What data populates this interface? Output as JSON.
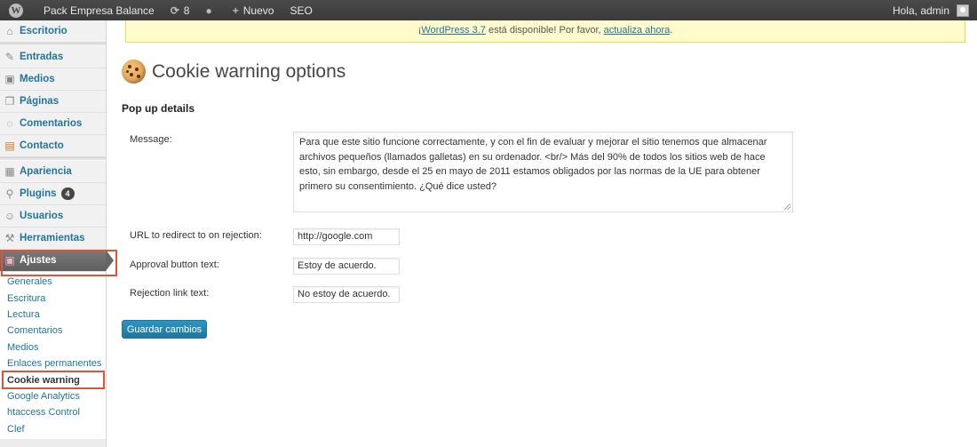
{
  "adminbar": {
    "site_name": "Pack Empresa Balance",
    "updates_count": "8",
    "new_label": "Nuevo",
    "seo_label": "SEO",
    "greeting": "Hola, admin"
  },
  "sidebar": {
    "items": [
      {
        "label": "Escritorio",
        "icon": "dashboard-icon"
      },
      {
        "label": "Entradas",
        "icon": "pin-icon"
      },
      {
        "label": "Medios",
        "icon": "media-icon"
      },
      {
        "label": "Páginas",
        "icon": "pages-icon"
      },
      {
        "label": "Comentarios",
        "icon": "comments-icon"
      },
      {
        "label": "Contacto",
        "icon": "contact-icon"
      },
      {
        "label": "Apariencia",
        "icon": "appearance-icon"
      },
      {
        "label": "Plugins",
        "icon": "plugins-icon",
        "badge": "4"
      },
      {
        "label": "Usuarios",
        "icon": "users-icon"
      },
      {
        "label": "Herramientas",
        "icon": "tools-icon"
      },
      {
        "label": "Ajustes",
        "icon": "settings-icon"
      }
    ],
    "submenu": [
      "Generales",
      "Escritura",
      "Lectura",
      "Comentarios",
      "Medios",
      "Enlaces permanentes",
      "Cookie warning",
      "Google Analytics",
      "htaccess Control",
      "Clef"
    ]
  },
  "notice": {
    "before": "¡",
    "link1": "WordPress 3.7",
    "middle": " está disponible! Por favor, ",
    "link2": "actualiza ahora",
    "after": "."
  },
  "page": {
    "title": "Cookie warning options",
    "section": "Pop up details"
  },
  "form": {
    "message_label": "Message:",
    "message_value": "Para que este sitio funcione correctamente, y con el fin de evaluar y mejorar el sitio tenemos que almacenar archivos pequeños (llamados galletas) en su ordenador. <br/> Más del 90% de todos los sitios web de hace esto, sin embargo, desde el 25 en mayo de 2011 estamos obligados por las normas de la UE para obtener primero su consentimiento. ¿Qué dice usted?",
    "redirect_label": "URL to redirect to on rejection:",
    "redirect_value": "http://google.com",
    "approval_label": "Approval button text:",
    "approval_value": "Estoy de acuerdo.",
    "rejection_label": "Rejection link text:",
    "rejection_value": "No estoy de acuerdo.",
    "save_label": "Guardar cambios"
  }
}
